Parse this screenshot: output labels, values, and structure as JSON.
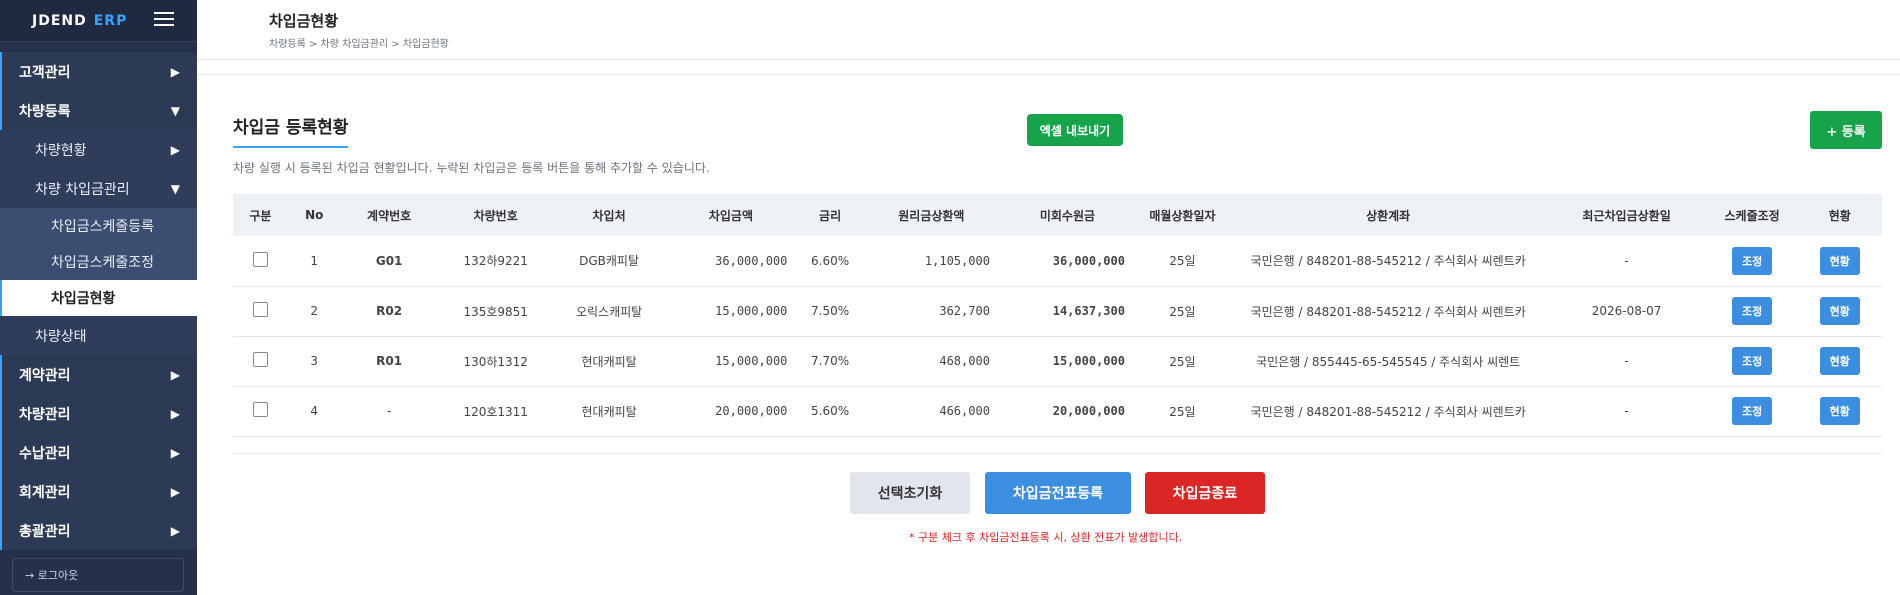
{
  "brand": {
    "part1": "JDEND",
    "part2": "ERP"
  },
  "sidebar": {
    "items": [
      {
        "label": "고객관리",
        "caret": "▶"
      },
      {
        "label": "차량등록",
        "caret": "▼"
      },
      {
        "label": "차량현황",
        "caret": "▶"
      },
      {
        "label": "차량 차입금관리",
        "caret": "▼"
      },
      {
        "label": "차입금스케줄등록"
      },
      {
        "label": "차입금스케줄조정"
      },
      {
        "label": "차입금현황"
      },
      {
        "label": "차량상태"
      },
      {
        "label": "계약관리",
        "caret": "▶"
      },
      {
        "label": "차량관리",
        "caret": "▶"
      },
      {
        "label": "수납관리",
        "caret": "▶"
      },
      {
        "label": "회계관리",
        "caret": "▶"
      },
      {
        "label": "총괄관리",
        "caret": "▶"
      }
    ],
    "logout": "→ 로그아웃"
  },
  "header": {
    "title": "차입금현황",
    "breadcrumb": "차량등록 > 차량 차입금관리 > 차입금현황"
  },
  "section": {
    "title": "차입금 등록현황",
    "description": "차량 실행 시 등록된 차입금 현황입니다. 누락된 차입금은 등록 버튼을 통해 추가할 수 있습니다.",
    "excel_button": "엑셀 내보내기",
    "add_button": "+ 등록"
  },
  "table": {
    "columns": [
      "구분",
      "No",
      "계약번호",
      "차량번호",
      "차입처",
      "차입금액",
      "금리",
      "원리금상환액",
      "미회수원금",
      "매월상환일자",
      "상환계좌",
      "최근차입금상환일",
      "스케줄조정",
      "현황"
    ],
    "rows": [
      {
        "no": "1",
        "contract": "G01",
        "car": "132하9221",
        "lender": "DGB캐피탈",
        "amount": "36,000,000",
        "rate": "6.60%",
        "repay": "1,105,000",
        "unrecovered": "36,000,000",
        "day": "25일",
        "account": "국민은행 / 848201-88-545212 / 주식회사 씨렌트카",
        "recent": "-",
        "adjust": "조정",
        "status": "현황"
      },
      {
        "no": "2",
        "contract": "R02",
        "car": "135호9851",
        "lender": "오릭스캐피탈",
        "amount": "15,000,000",
        "rate": "7.50%",
        "repay": "362,700",
        "unrecovered": "14,637,300",
        "day": "25일",
        "account": "국민은행 / 848201-88-545212 / 주식회사 씨렌트카",
        "recent": "2026-08-07",
        "adjust": "조정",
        "status": "현황"
      },
      {
        "no": "3",
        "contract": "R01",
        "car": "130하1312",
        "lender": "현대캐피탈",
        "amount": "15,000,000",
        "rate": "7.70%",
        "repay": "468,000",
        "unrecovered": "15,000,000",
        "day": "25일",
        "account": "국민은행 / 855445-65-545545 / 주식회사 씨렌트",
        "recent": "-",
        "adjust": "조정",
        "status": "현황"
      },
      {
        "no": "4",
        "contract": "-",
        "car": "120호1311",
        "lender": "현대캐피탈",
        "amount": "20,000,000",
        "rate": "5.60%",
        "repay": "466,000",
        "unrecovered": "20,000,000",
        "day": "25일",
        "account": "국민은행 / 848201-88-545212 / 주식회사 씨렌트카",
        "recent": "-",
        "adjust": "조정",
        "status": "현황"
      }
    ]
  },
  "actions": {
    "reset": "선택초기화",
    "voucher": "차입금전표등록",
    "end": "차입금종료",
    "notice": "* 구분 체크 후 차입금전표등록 시, 상환 전표가 발생합니다."
  },
  "colors": {
    "sidebar_bg": "#25314a",
    "accent_blue": "#3b8ee0",
    "green": "#16a34a",
    "red": "#dc2626"
  }
}
